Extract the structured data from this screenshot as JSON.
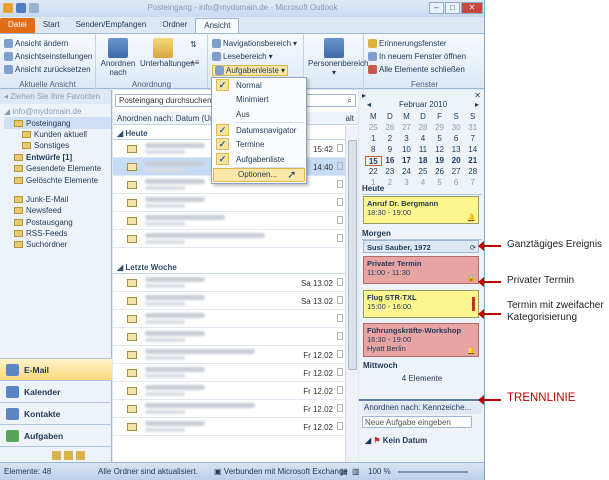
{
  "window": {
    "title": "Posteingang - info@mydomain.de - Microsoft Outlook",
    "tabs": [
      "Datei",
      "Start",
      "Senden/Empfangen",
      "Ordner",
      "Ansicht"
    ],
    "active_tab": "Ansicht"
  },
  "ribbon": {
    "groups": [
      {
        "label": "Aktuelle Ansicht",
        "items": [
          "Ansicht ändern",
          "Ansichtseinstellungen",
          "Ansicht zurücksetzen"
        ]
      },
      {
        "label": "Anordnung",
        "items": [
          "Anordnen nach",
          "Unterhaltungen"
        ]
      },
      {
        "label": "",
        "items": [
          "Navigationsbereich",
          "Lesebereich",
          "Aufgabenleiste"
        ]
      },
      {
        "label": "",
        "items": [
          "Personenbereich"
        ]
      },
      {
        "label": "Fenster",
        "items": [
          "Erinnerungsfenster",
          "In neuem Fenster öffnen",
          "Alle Elemente schließen"
        ]
      }
    ]
  },
  "dropdown": {
    "items": [
      {
        "label": "Normal",
        "checked": true
      },
      {
        "label": "Minimiert",
        "checked": false
      },
      {
        "label": "Aus",
        "checked": false
      },
      {
        "label": "Datumsnavigator",
        "checked": true
      },
      {
        "label": "Termine",
        "checked": true
      },
      {
        "label": "Aufgabenliste",
        "checked": true
      },
      {
        "label": "Optionen...",
        "checked": false
      }
    ]
  },
  "nav": {
    "favorites_header": "Ziehen Sie Ihre Favoriten",
    "folders": [
      "Posteingang",
      "Kunden aktuell",
      "Sonstiges",
      "Entwürfe [1]",
      "Gesendete Elemente",
      "Gelöschte Elemente",
      "Junk-E-Mail",
      "Newsfeed",
      "Postausgang",
      "RSS-Feeds",
      "Suchordner"
    ],
    "buttons": [
      "E-Mail",
      "Kalender",
      "Kontakte",
      "Aufgaben"
    ]
  },
  "list": {
    "search_placeholder": "Posteingang durchsuchen (Str",
    "sort_label": "Anordnen nach: Datum (Unter",
    "sort_right": "alt",
    "group_today": "Heute",
    "group_last_week": "Letzte Woche",
    "today_times": [
      "15:42",
      "14:40",
      "",
      "",
      "",
      ""
    ],
    "week_dates": [
      "Sa 13.02",
      "Sa 13.02",
      "",
      "",
      "Fr 12.02",
      "Fr 12.02",
      "Fr 12.02",
      "Fr 12.02",
      "Fr 12.02"
    ]
  },
  "todo": {
    "month": "Februar 2010",
    "weekdays": [
      "M",
      "D",
      "M",
      "D",
      "F",
      "S",
      "S"
    ],
    "weeks": [
      [
        "25",
        "26",
        "27",
        "28",
        "29",
        "30",
        "31"
      ],
      [
        "1",
        "2",
        "3",
        "4",
        "5",
        "6",
        "7"
      ],
      [
        "8",
        "9",
        "10",
        "11",
        "12",
        "13",
        "14"
      ],
      [
        "15",
        "16",
        "17",
        "18",
        "19",
        "20",
        "21"
      ],
      [
        "22",
        "23",
        "24",
        "25",
        "26",
        "27",
        "28"
      ],
      [
        "1",
        "2",
        "3",
        "4",
        "5",
        "6",
        "7"
      ]
    ],
    "today_label": "Heute",
    "tomorrow_label": "Morgen",
    "wednesday_label": "Mittwoch",
    "elements_count": "4 Elemente",
    "appointments": [
      {
        "title": "Anruf Dr. Bergmann",
        "time": "18:30 - 19:00",
        "color": "#fdf68f"
      },
      {
        "title": "Susi Sauber, 1972",
        "time": "",
        "color": "#dde8f5"
      },
      {
        "title": "Privater Termin",
        "time": "11:00 - 11:30",
        "color": "#e8a3a3"
      },
      {
        "title": "Flug STR-TXL",
        "time": "15:00 - 16:00",
        "color": "#fdf68f"
      },
      {
        "title": "Führungskräfte-Workshop",
        "time": "16:30 - 19:00",
        "location": "Hyatt Berlin",
        "color": "#e8a3a3"
      }
    ],
    "task_sort": "Anordnen nach: Kennzeiche...",
    "task_placeholder": "Neue Aufgabe eingeben",
    "task_group": "Kein Datum"
  },
  "status": {
    "count": "Elemente: 48",
    "sync": "Alle Ordner sind aktualisiert.",
    "exchange": "Verbunden mit Microsoft Exchange",
    "zoom": "100 %"
  },
  "annotations": {
    "all_day": "Ganztägiges Ereignis",
    "private": "Privater Termin",
    "double_cat": "Termin mit zweifacher Kategorisierung",
    "separator": "TRENNLINIE"
  }
}
